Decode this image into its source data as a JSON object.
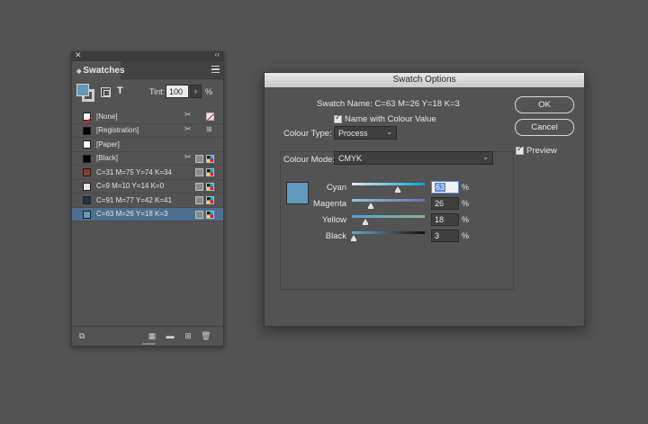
{
  "swatches_panel": {
    "tab_title": "Swatches",
    "tint_label": "Tint:",
    "tint_value": "100",
    "tint_unit": "%",
    "fill_color": "#6299bc",
    "items": [
      {
        "label": "[None]",
        "color": "none",
        "icons": [
          "scissors",
          "no-print"
        ]
      },
      {
        "label": "[Registration]",
        "color": "#000000",
        "icons": [
          "scissors",
          "registration"
        ]
      },
      {
        "label": "[Paper]",
        "color": "#ffffff",
        "icons": []
      },
      {
        "label": "[Black]",
        "color": "#000000",
        "icons": [
          "scissors",
          "gray",
          "cmyk"
        ]
      },
      {
        "label": "C=31 M=75 Y=74 K=34",
        "color": "#8c3b2e",
        "icons": [
          "gray",
          "cmyk"
        ]
      },
      {
        "label": "C=9 M=10 Y=14 K=0",
        "color": "#ece6dc",
        "icons": [
          "gray",
          "cmyk"
        ]
      },
      {
        "label": "C=91 M=77 Y=42 K=41",
        "color": "#22304f",
        "icons": [
          "gray",
          "cmyk"
        ]
      },
      {
        "label": "C=63 M=26 Y=18 K=3",
        "color": "#6299bc",
        "icons": [
          "gray",
          "cmyk"
        ],
        "selected": true
      }
    ]
  },
  "dialog": {
    "title": "Swatch Options",
    "swatch_name_label": "Swatch Name:",
    "swatch_name_value": "C=63 M=26 Y=18 K=3",
    "name_with_value_label": "Name with Colour Value",
    "colour_type_label": "Colour Type:",
    "colour_type_value": "Process",
    "colour_mode_label": "Colour Mode:",
    "colour_mode_value": "CMYK",
    "preview_color": "#6299bc",
    "sliders": [
      {
        "label": "Cyan",
        "value": "63",
        "fraction": 0.63
      },
      {
        "label": "Magenta",
        "value": "26",
        "fraction": 0.26
      },
      {
        "label": "Yellow",
        "value": "18",
        "fraction": 0.18
      },
      {
        "label": "Black",
        "value": "3",
        "fraction": 0.03
      }
    ],
    "percent_unit": "%",
    "ok_label": "OK",
    "cancel_label": "Cancel",
    "preview_label": "Preview"
  }
}
